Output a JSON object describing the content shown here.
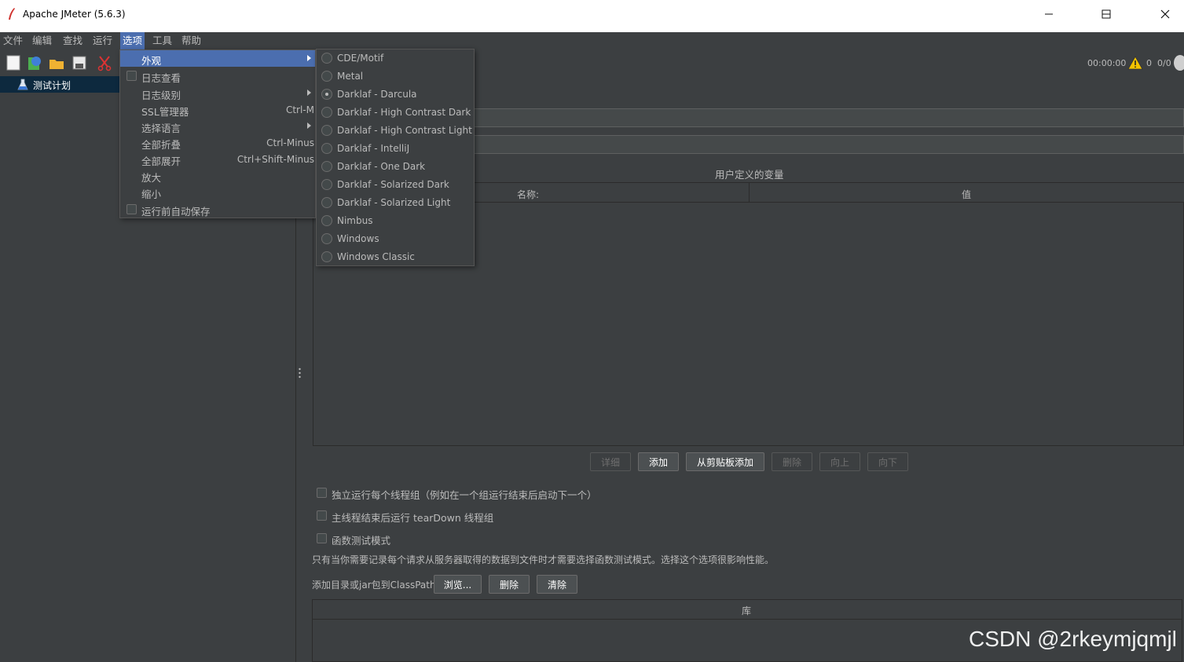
{
  "window": {
    "title": "Apache JMeter (5.6.3)",
    "minimize_glyph": "—",
    "maximize_glyph": "☐",
    "close_glyph": "✕"
  },
  "menubar": {
    "items": [
      {
        "label": "文件"
      },
      {
        "label": "编辑"
      },
      {
        "label": "查找"
      },
      {
        "label": "运行"
      },
      {
        "label": "选项"
      },
      {
        "label": "工具"
      },
      {
        "label": "帮助"
      }
    ]
  },
  "toolbar": {
    "icons": [
      "new-icon",
      "templates-icon",
      "open-icon",
      "save-icon",
      "cut-icon"
    ]
  },
  "status": {
    "time": "00:00:00",
    "warnings": "0",
    "threads": "0/0"
  },
  "tree": {
    "nodes": [
      {
        "label": "测试计划",
        "selected": true
      }
    ]
  },
  "options_menu": {
    "items": [
      {
        "label": "外观",
        "shortcut": "",
        "submenu": true,
        "checkbox": false,
        "highlighted": true
      },
      {
        "label": "日志查看",
        "shortcut": "",
        "submenu": false,
        "checkbox": true
      },
      {
        "label": "日志级别",
        "shortcut": "",
        "submenu": true,
        "checkbox": false
      },
      {
        "label": "SSL管理器",
        "shortcut": "Ctrl-M",
        "submenu": false,
        "checkbox": false
      },
      {
        "label": "选择语言",
        "shortcut": "",
        "submenu": true,
        "checkbox": false
      },
      {
        "label": "全部折叠",
        "shortcut": "Ctrl-Minus",
        "submenu": false,
        "checkbox": false
      },
      {
        "label": "全部展开",
        "shortcut": "Ctrl+Shift-Minus",
        "submenu": false,
        "checkbox": false
      },
      {
        "label": "放大",
        "shortcut": "",
        "submenu": false,
        "checkbox": false
      },
      {
        "label": "缩小",
        "shortcut": "",
        "submenu": false,
        "checkbox": false
      },
      {
        "label": "运行前自动保存",
        "shortcut": "",
        "submenu": false,
        "checkbox": true
      }
    ]
  },
  "laf_menu": {
    "items": [
      {
        "label": "CDE/Motif",
        "selected": false
      },
      {
        "label": "Metal",
        "selected": false
      },
      {
        "label": "Darklaf - Darcula",
        "selected": true
      },
      {
        "label": "Darklaf - High Contrast Dark",
        "selected": false
      },
      {
        "label": "Darklaf - High Contrast Light",
        "selected": false
      },
      {
        "label": "Darklaf - IntelliJ",
        "selected": false
      },
      {
        "label": "Darklaf - One Dark",
        "selected": false
      },
      {
        "label": "Darklaf - Solarized Dark",
        "selected": false
      },
      {
        "label": "Darklaf - Solarized Light",
        "selected": false
      },
      {
        "label": "Nimbus",
        "selected": false
      },
      {
        "label": "Windows",
        "selected": false
      },
      {
        "label": "Windows Classic",
        "selected": false
      }
    ]
  },
  "test_plan": {
    "variables_title": "用户定义的变量",
    "columns": {
      "name": "名称:",
      "value": "值"
    },
    "buttons": {
      "detail": "详细",
      "add": "添加",
      "add_from_clipboard": "从剪贴板添加",
      "delete": "删除",
      "up": "向上",
      "down": "向下"
    },
    "checkboxes": {
      "serialize": "独立运行每个线程组（例如在一个组运行结束后启动下一个）",
      "teardown": "主线程结束后运行 tearDown 线程组",
      "functional": "函数测试模式"
    },
    "functional_note": "只有当你需要记录每个请求从服务器取得的数据到文件时才需要选择函数测试模式。选择这个选项很影响性能。",
    "classpath": {
      "label": "添加目录或jar包到ClassPath",
      "browse": "浏览...",
      "delete": "删除",
      "clear": "清除",
      "library_header": "库"
    }
  },
  "watermark": "CSDN @2rkeymjqmjl",
  "colors": {
    "background": "#3c3f41",
    "menu_highlight": "#4b6eaf",
    "tree_selection": "#0d293e",
    "text": "#bbbbbb"
  }
}
